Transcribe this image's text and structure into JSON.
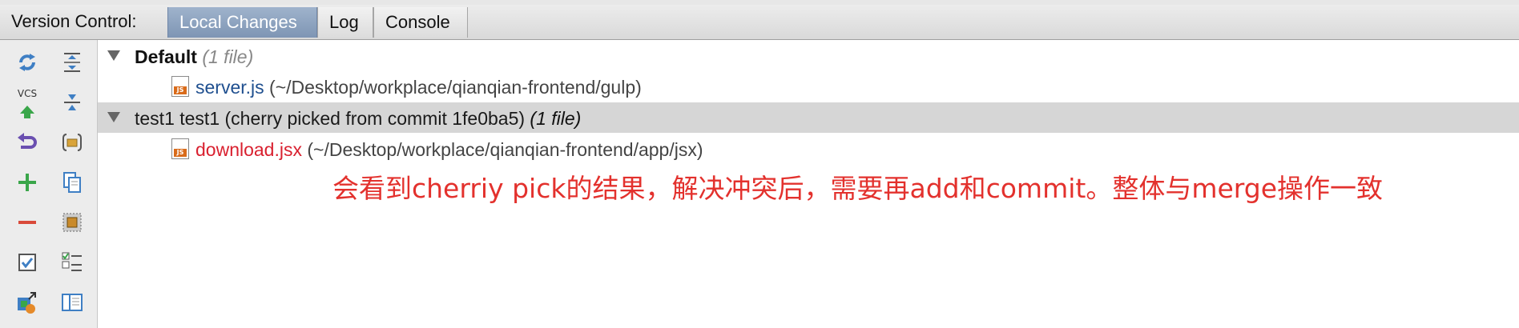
{
  "panel": {
    "label": "Version Control:",
    "tabs": [
      {
        "label": "Local Changes",
        "active": true
      },
      {
        "label": "Log",
        "active": false
      },
      {
        "label": "Console",
        "active": false
      }
    ]
  },
  "toolbar": {
    "vcs_label": "VCS",
    "icons": [
      "refresh-icon",
      "expand-all-icon",
      "vcs-commit-icon",
      "collapse-all-icon",
      "revert-icon",
      "group-by-icon",
      "add-changelist-icon",
      "copy-icon",
      "remove-changelist-icon",
      "shelve-icon",
      "checkbox-icon",
      "show-diff-list-icon",
      "move-to-changelist-icon",
      "preview-panel-icon"
    ]
  },
  "changelists": [
    {
      "name": "Default",
      "count": "(1 file)",
      "files": [
        {
          "name": "server.js",
          "path": "(~/Desktop/workplace/qianqian-frontend/gulp)",
          "color": "#1f4f8f"
        }
      ]
    },
    {
      "name": "test1 test1 (cherry picked from commit 1fe0ba5)",
      "count": "(1 file)",
      "files": [
        {
          "name": "download.jsx",
          "path": "(~/Desktop/workplace/qianqian-frontend/app/jsx)",
          "color": "#d9202f"
        }
      ]
    }
  ],
  "annotation": "会看到cherriy pick的结果，解决冲突后，需要再add和commit。整体与merge操作一致"
}
